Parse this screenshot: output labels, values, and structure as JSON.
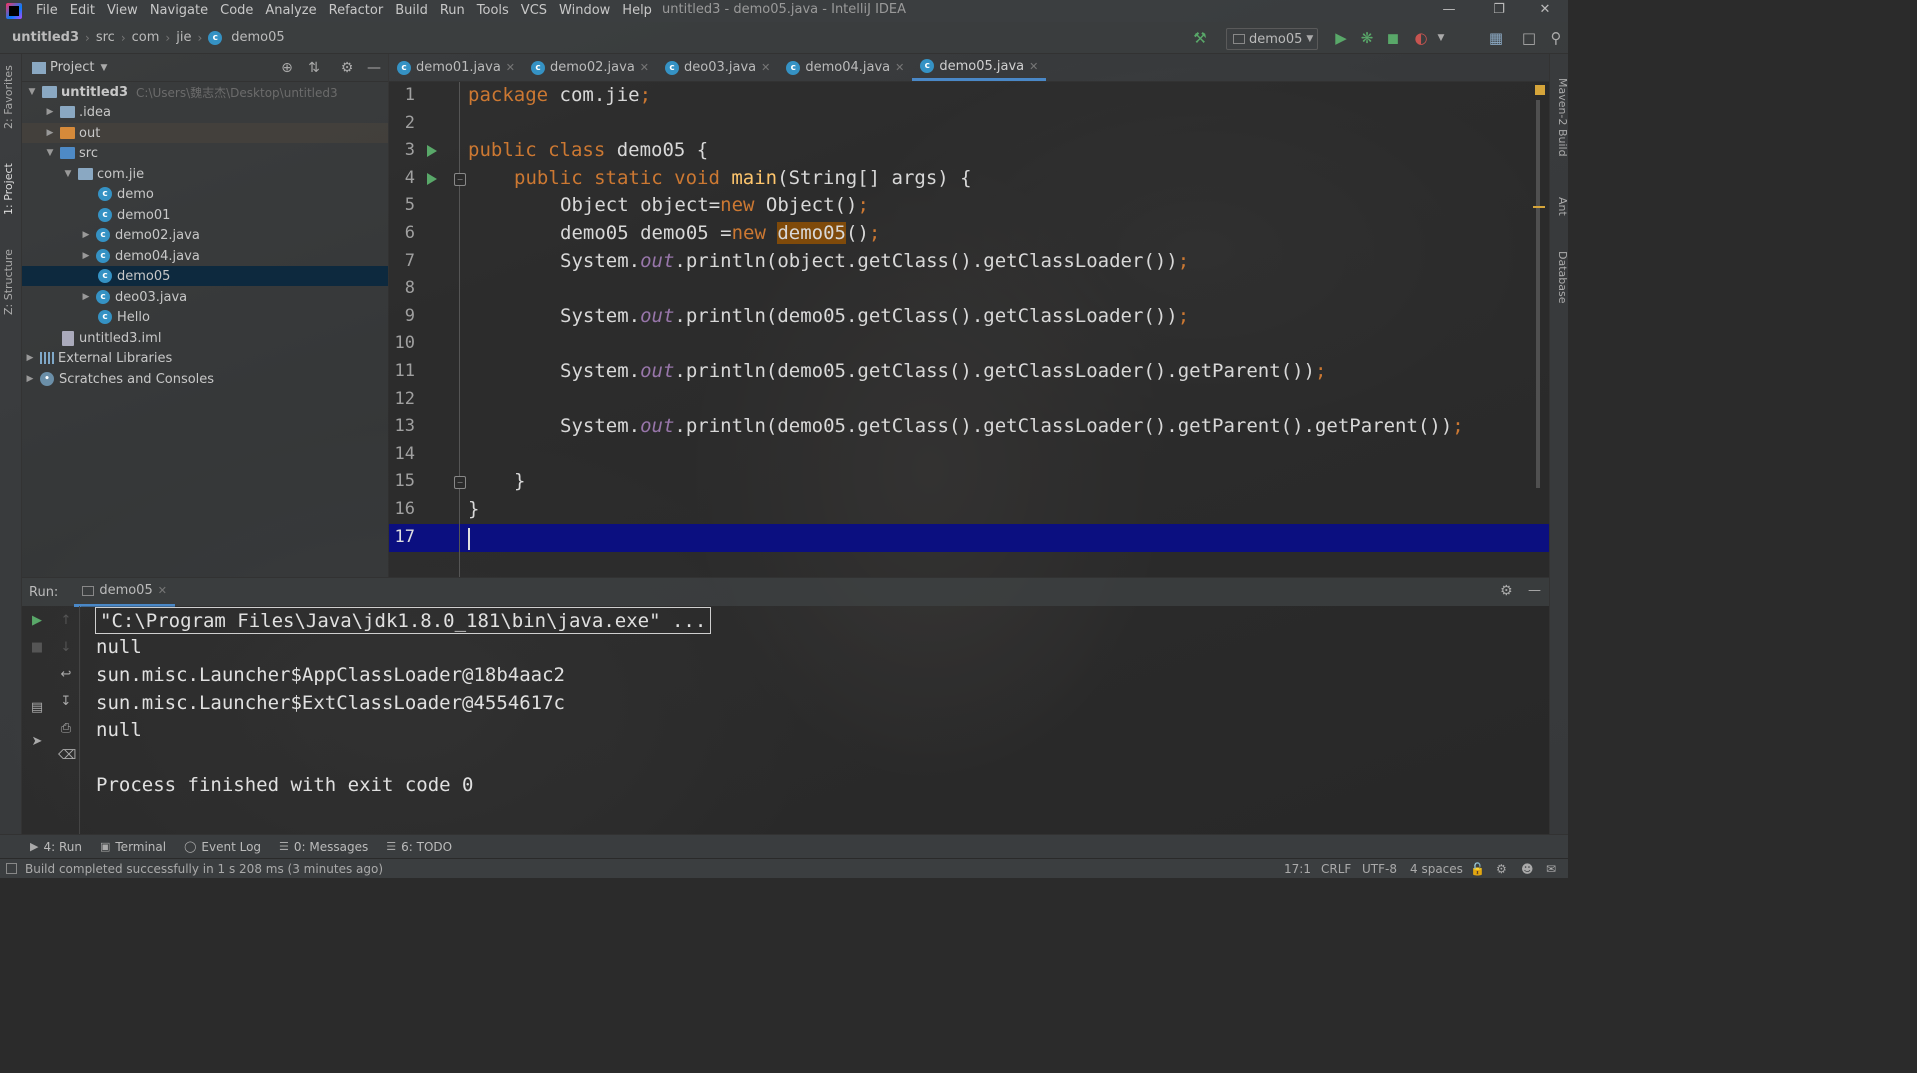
{
  "app": {
    "window_title": "untitled3 - demo05.java - IntelliJ IDEA",
    "menu": [
      "File",
      "Edit",
      "View",
      "Navigate",
      "Code",
      "Analyze",
      "Refactor",
      "Build",
      "Run",
      "Tools",
      "VCS",
      "Window",
      "Help"
    ]
  },
  "breadcrumbs": [
    "untitled3",
    "src",
    "com",
    "jie",
    "demo05"
  ],
  "toolbar": {
    "run_config": "demo05"
  },
  "left_tool_tabs": [
    "2: Favorites",
    "1: Project",
    "Z: Structure"
  ],
  "right_tool_tabs": [
    "Maven-2 Build",
    "Ant",
    "Database"
  ],
  "project_panel": {
    "title": "Project",
    "tree": [
      {
        "label": "untitled3",
        "path": "C:\\Users\\魏志杰\\Desktop\\untitled3",
        "icon": "folder"
      },
      {
        "label": ".idea",
        "icon": "folder"
      },
      {
        "label": "out",
        "icon": "folder-orange"
      },
      {
        "label": "src",
        "icon": "folder-blue"
      },
      {
        "label": "com.jie",
        "icon": "package"
      },
      {
        "label": "demo",
        "icon": "class"
      },
      {
        "label": "demo01",
        "icon": "class"
      },
      {
        "label": "demo02.java",
        "icon": "class"
      },
      {
        "label": "demo04.java",
        "icon": "class"
      },
      {
        "label": "demo05",
        "icon": "class",
        "selected": true
      },
      {
        "label": "deo03.java",
        "icon": "class"
      },
      {
        "label": "Hello",
        "icon": "class"
      },
      {
        "label": "untitled3.iml",
        "icon": "file"
      },
      {
        "label": "External Libraries",
        "icon": "library"
      },
      {
        "label": "Scratches and Consoles",
        "icon": "scratch"
      }
    ]
  },
  "editor_tabs": [
    {
      "label": "demo01.java"
    },
    {
      "label": "demo02.java"
    },
    {
      "label": "deo03.java"
    },
    {
      "label": "demo04.java"
    },
    {
      "label": "demo05.java",
      "active": true
    }
  ],
  "editor": {
    "line_numbers": [
      "1",
      "2",
      "3",
      "4",
      "5",
      "6",
      "7",
      "8",
      "9",
      "10",
      "11",
      "12",
      "13",
      "14",
      "15",
      "16",
      "17"
    ],
    "current_line": "17",
    "code": {
      "l1_kw": "package ",
      "l1_rest": "com.jie",
      "l3_kw1": "public ",
      "l3_kw2": "class ",
      "l3_rest": "demo05 {",
      "l4_kw1": "public ",
      "l4_kw2": "static ",
      "l4_kw3": "void ",
      "l4_fn": "main",
      "l4_rest": "(String[] args) {",
      "l5_a": "Object object=",
      "l5_kw": "new ",
      "l5_b": "Object()",
      "l6_a": "demo05 demo05 =",
      "l6_kw": "new ",
      "l6_hl": "demo05",
      "l6_b": "()",
      "l7_a": "System.",
      "l7_st": "out",
      "l7_b": ".println(object.getClass().getClassLoader())",
      "l9_a": "System.",
      "l9_st": "out",
      "l9_b": ".println(demo05.getClass().getClassLoader())",
      "l11_a": "System.",
      "l11_st": "out",
      "l11_b": ".println(demo05.getClass().getClassLoader().getParent())",
      "l13_a": "System.",
      "l13_st": "out",
      "l13_b": ".println(demo05.getClass().getClassLoader().getParent().getParent())",
      "l15": "}",
      "l16": "}",
      "semi": ";"
    }
  },
  "run_panel": {
    "label": "Run:",
    "tab": "demo05",
    "console": [
      "\"C:\\Program Files\\Java\\jdk1.8.0_181\\bin\\java.exe\" ...",
      "null",
      "sun.misc.Launcher$AppClassLoader@18b4aac2",
      "sun.misc.Launcher$ExtClassLoader@4554617c",
      "null",
      "",
      "Process finished with exit code 0"
    ]
  },
  "bottom_tools": [
    "4: Run",
    "Terminal",
    "Event Log",
    "0: Messages",
    "6: TODO"
  ],
  "status": {
    "message": "Build completed successfully in 1 s 208 ms (3 minutes ago)",
    "position": "17:1",
    "line_sep": "CRLF",
    "encoding": "UTF-8",
    "indent": "4 spaces"
  },
  "colors": {
    "keyword": "#cc7832",
    "method": "#ffc66d",
    "static_field": "#9876aa",
    "current_line": "#0b0f80",
    "selection": "#0d293e",
    "run_icon": "#59a869"
  }
}
